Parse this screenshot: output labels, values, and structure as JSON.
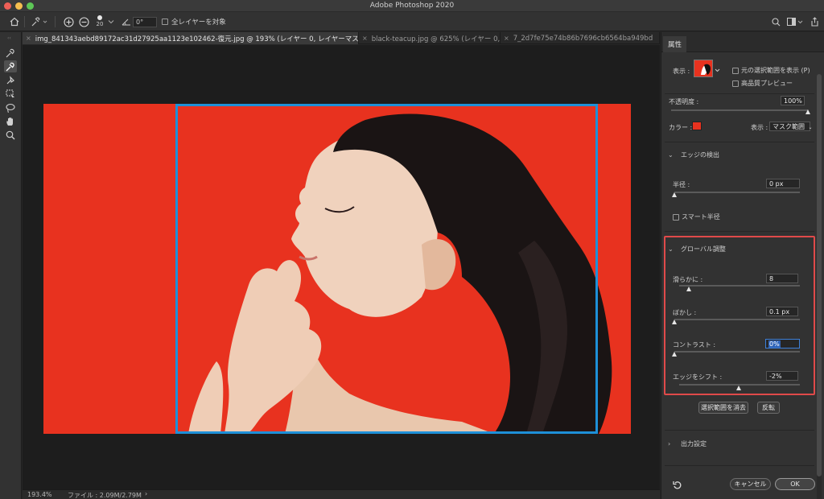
{
  "window": {
    "title": "Adobe Photoshop 2020"
  },
  "options_bar": {
    "brush_size": "20",
    "angle": "0°",
    "sample_all_layers": "全レイヤーを対象"
  },
  "tabs": [
    {
      "label": "img_841343aebd89172ac31d27925aa1123e102462-復元.jpg @ 193% (レイヤー 0, レイヤーマスク/8) *",
      "active": true
    },
    {
      "label": "black-teacup.jpg @ 625% (レイヤー 0, ...",
      "active": false
    },
    {
      "label": "7_2d7fe75e74b86b7696cb6564ba949bd",
      "active": false
    }
  ],
  "status": {
    "zoom": "193.4%",
    "file_info": "ファイル : 2.09M/2.79M",
    "arrow": "›"
  },
  "panel": {
    "tab_label": "属性",
    "view_label": "表示 :",
    "show_original_label": "元の選択範囲を表示 (P)",
    "high_quality_label": "高品質プレビュー",
    "opacity_label": "不透明度 :",
    "opacity_value": "100%",
    "opacity_level": 1.0,
    "color_label": "カラー :",
    "color_swatch": "#e8321f",
    "display_label": "表示 :",
    "display_value": "マスク範囲",
    "edge_detection": {
      "title": "エッジの検出",
      "radius_label": "半径 :",
      "radius_value": "0 px",
      "radius_level": 0.0,
      "smart_radius_label": "スマート半径"
    },
    "global": {
      "title": "グローバル調整",
      "smooth_label": "滑らかに :",
      "smooth_value": "8",
      "smooth_level": 0.08,
      "feather_label": "ぼかし :",
      "feather_value": "0.1 px",
      "feather_level": 0.0,
      "contrast_label": "コントラスト :",
      "contrast_value": "0%",
      "contrast_level": 0.0,
      "shift_label": "エッジをシフト :",
      "shift_value": "-2%",
      "shift_level": 0.49
    },
    "clear_selection_label": "選択範囲を消去",
    "invert_label": "反転",
    "output_title": "出力設定",
    "cancel_label": "キャンセル",
    "ok_label": "OK"
  }
}
